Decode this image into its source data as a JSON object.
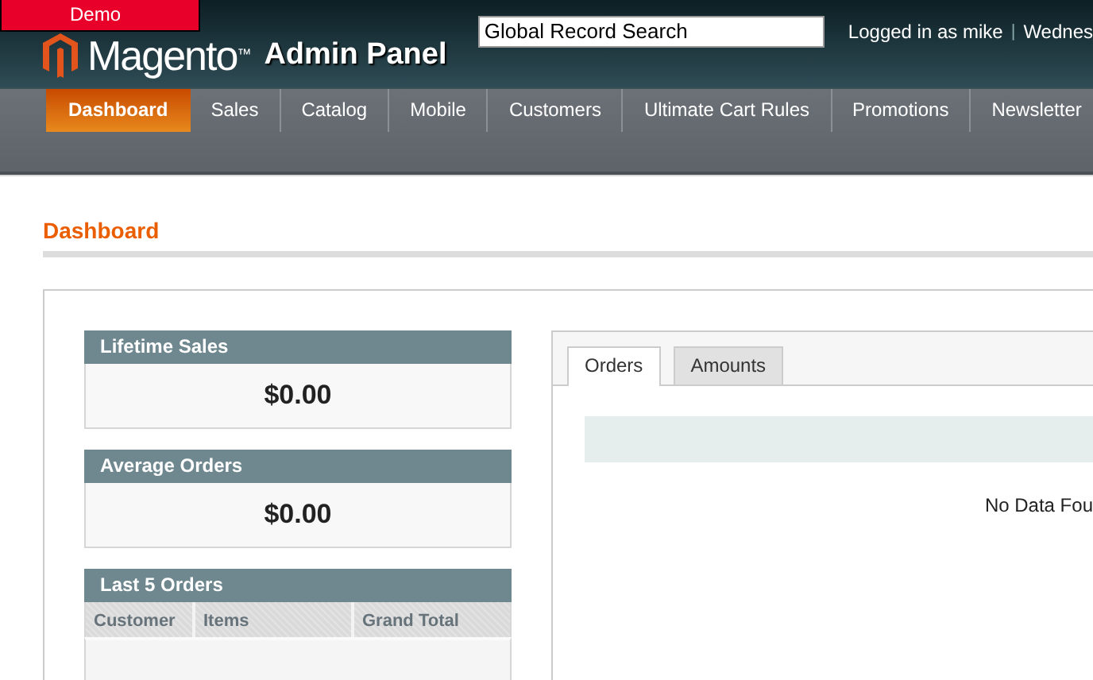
{
  "demo_badge": "Demo",
  "header": {
    "logo_text": "Magento",
    "logo_mark": "™",
    "logo_subtitle": "Admin Panel",
    "search": {
      "value": "Global Record Search"
    },
    "user_text": "Logged in as mike",
    "separator": "|",
    "date_text": "Wednes"
  },
  "nav": [
    {
      "label": "Dashboard",
      "selected": true
    },
    {
      "label": "Sales",
      "selected": false
    },
    {
      "label": "Catalog",
      "selected": false
    },
    {
      "label": "Mobile",
      "selected": false
    },
    {
      "label": "Customers",
      "selected": false
    },
    {
      "label": "Ultimate Cart Rules",
      "selected": false
    },
    {
      "label": "Promotions",
      "selected": false
    },
    {
      "label": "Newsletter",
      "selected": false
    }
  ],
  "page_title": "Dashboard",
  "stats": [
    {
      "title": "Lifetime Sales",
      "value": "$0.00"
    },
    {
      "title": "Average Orders",
      "value": "$0.00"
    }
  ],
  "last_orders": {
    "title": "Last 5 Orders",
    "columns": [
      "Customer",
      "Items",
      "Grand Total"
    ]
  },
  "chart_panel": {
    "tabs": [
      {
        "label": "Orders",
        "selected": true
      },
      {
        "label": "Amounts",
        "selected": false
      }
    ],
    "empty_text": "No Data Fou"
  }
}
